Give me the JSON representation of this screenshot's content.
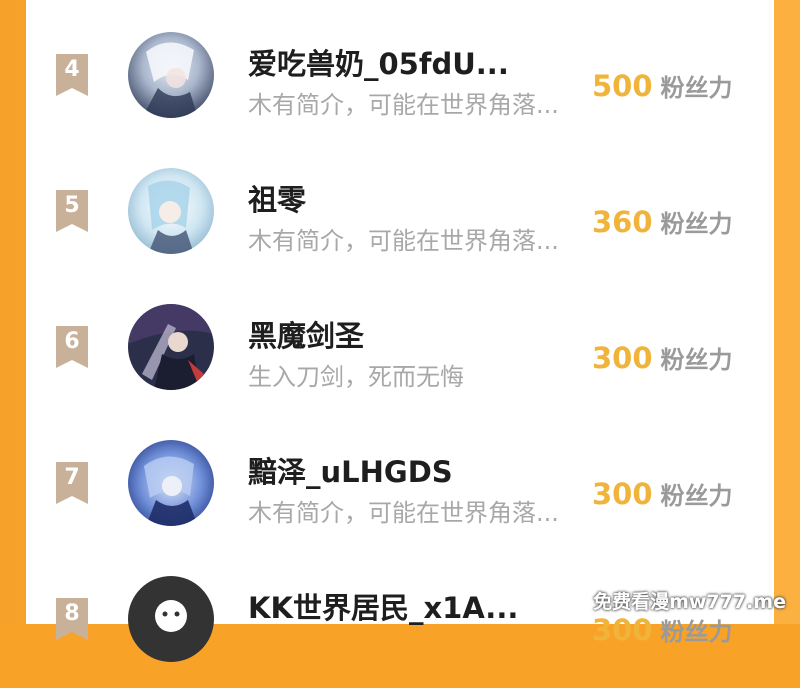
{
  "leaderboard": {
    "rows": [
      {
        "rank": "4",
        "name": "爱吃兽奶_05fdU...",
        "bio": "木有简介，可能在世界角落...",
        "fans_count": "500",
        "fans_label": "粉丝力"
      },
      {
        "rank": "5",
        "name": "祖零",
        "bio": "木有简介，可能在世界角落...",
        "fans_count": "360",
        "fans_label": "粉丝力"
      },
      {
        "rank": "6",
        "name": "黑魔剑圣",
        "bio": "生入刀剑，死而无悔",
        "fans_count": "300",
        "fans_label": "粉丝力"
      },
      {
        "rank": "7",
        "name": "黯泽_uLHGDS",
        "bio": "木有简介，可能在世界角落...",
        "fans_count": "300",
        "fans_label": "粉丝力"
      },
      {
        "rank": "8",
        "name": "KK世界居民_x1A...",
        "bio": "",
        "fans_count": "300",
        "fans_label": "粉丝力"
      }
    ]
  },
  "watermark": {
    "text": "免费看漫mw777.me"
  },
  "colors": {
    "accent_orange": "#f6a12a",
    "fans_gold": "#f0b43a",
    "rank_badge": "#c9b199",
    "name_text": "#1e1e1e",
    "bio_text": "#a8a8a8"
  }
}
